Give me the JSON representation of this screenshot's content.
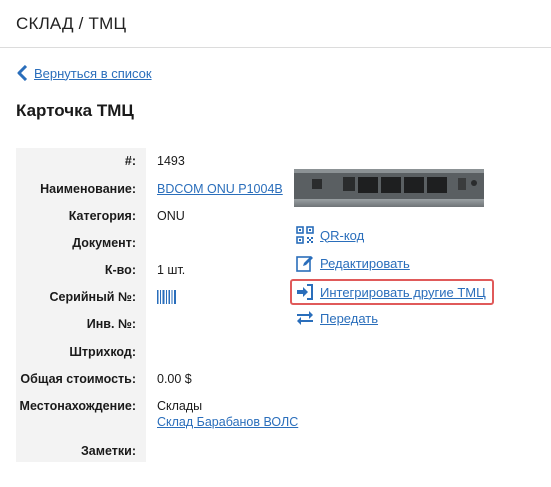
{
  "header": {
    "title": "СКЛАД / ТМЦ"
  },
  "back": {
    "label": "Вернуться в список"
  },
  "card": {
    "title": "Карточка ТМЦ"
  },
  "fields": {
    "id": {
      "label": "#:",
      "value": "1493"
    },
    "name": {
      "label": "Наименование:",
      "value": "BDCOM ONU P1004B"
    },
    "category": {
      "label": "Категория:",
      "value": "ONU"
    },
    "document": {
      "label": "Документ:",
      "value": ""
    },
    "qty": {
      "label": "К-во:",
      "value": "1 шт."
    },
    "serial": {
      "label": "Серийный №:",
      "value": ""
    },
    "inv": {
      "label": "Инв. №:",
      "value": ""
    },
    "barcode": {
      "label": "Штрихкод:",
      "value": ""
    },
    "cost": {
      "label": "Общая стоимость:",
      "value": "0.00 $"
    },
    "location": {
      "label": "Местонахождение:",
      "value": "Склады",
      "link": "Склад Барабанов ВОЛС"
    },
    "notes": {
      "label": "Заметки:",
      "value": ""
    }
  },
  "actions": {
    "qr": "QR-код",
    "edit": "Редактировать",
    "integrate": "Интегрировать другие ТМЦ",
    "transfer": "Передать"
  },
  "colors": {
    "link": "#2a6ebb",
    "highlight": "#e05a5a",
    "label_bg": "#f3f3f3"
  }
}
